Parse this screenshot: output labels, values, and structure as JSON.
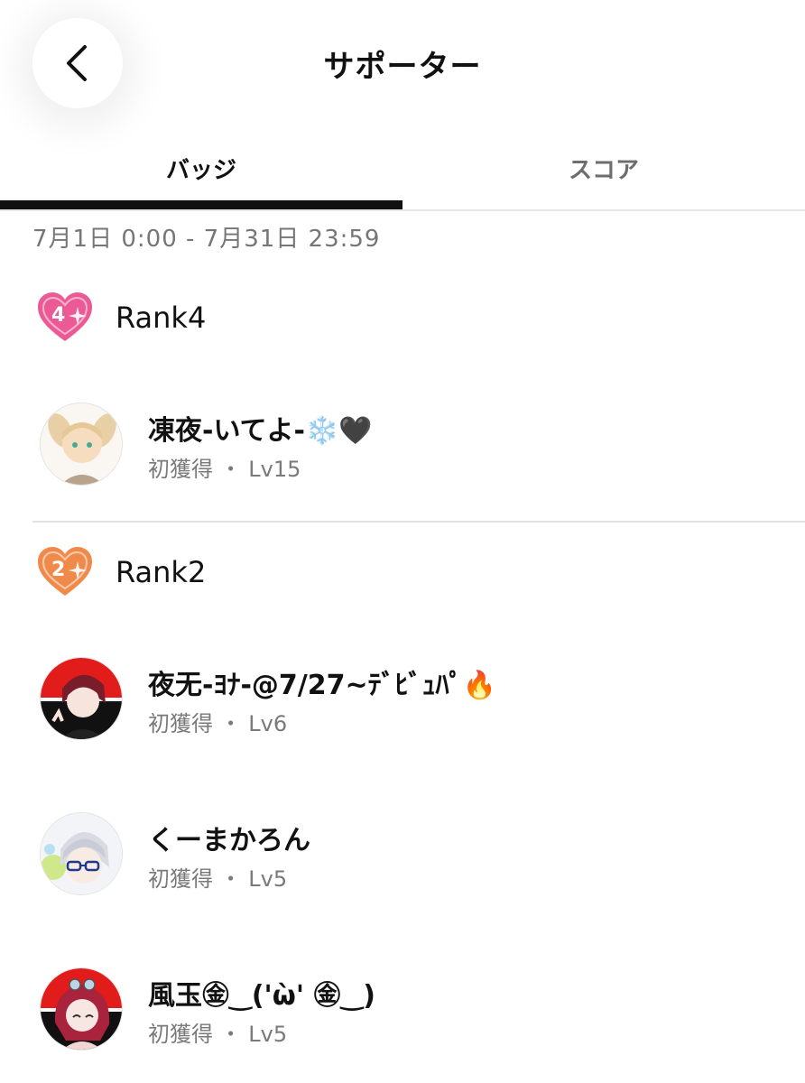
{
  "header": {
    "title": "サポーター",
    "back_icon": "chevron-left-icon"
  },
  "tabs": [
    {
      "label": "バッジ",
      "active": true
    },
    {
      "label": "スコア",
      "active": false
    }
  ],
  "date_range": "7月1日 0:00 - 7月31日 23:59",
  "ranks": [
    {
      "label": "Rank4",
      "icon_number": "4",
      "icon_color": "#ec5a96",
      "icon": "heart-badge-icon",
      "users": [
        {
          "name": "凍夜-いてよ-❄️🖤",
          "meta": "初獲得 ・ Lv15"
        }
      ]
    },
    {
      "label": "Rank2",
      "icon_number": "2",
      "icon_color": "#f08a4b",
      "icon": "heart-badge-icon",
      "users": [
        {
          "name": "夜无-ﾖﾅ-@7/27~ﾃﾞﾋﾞｭﾊﾟ🔥",
          "meta": "初獲得 ・ Lv6"
        },
        {
          "name": "くーまかろん",
          "meta": "初獲得 ・ Lv5"
        },
        {
          "name": "風玉㊎‿('ὼ' ㊎‿)",
          "meta": "初獲得 ・ Lv5"
        }
      ]
    }
  ]
}
